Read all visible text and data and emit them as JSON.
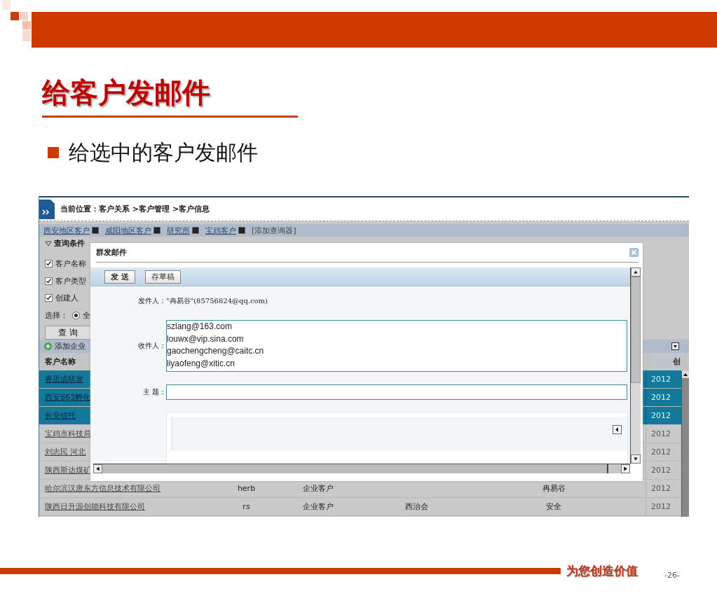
{
  "slide": {
    "title": "给客户发邮件",
    "bullets": [
      "给选中的客户发邮件"
    ],
    "slogan": "为您创造价值",
    "page": "-26-"
  },
  "app": {
    "breadcrumb": "当前位置：客户关系 >客户管理 >客户信息",
    "query_tabs": [
      {
        "label": "西安地区客户",
        "kind": "saved"
      },
      {
        "label": "咸阳地区客户",
        "kind": "saved"
      },
      {
        "label": "研究所",
        "kind": "saved"
      },
      {
        "label": "宝鸡客户",
        "kind": "saved"
      },
      {
        "label": "[添加查询器]",
        "kind": "add"
      }
    ],
    "query_panel": {
      "title": "查询条件",
      "expanded": true,
      "conditions": [
        {
          "label": "客户名称",
          "checked": true
        },
        {
          "label": "客户类型",
          "checked": true
        },
        {
          "label": "创建人",
          "checked": true
        }
      ],
      "select_label": "选择：",
      "select_option": {
        "label": "全",
        "selected": true
      },
      "search_button": "查 询"
    },
    "add_link": "添加企业",
    "table": {
      "columns": [
        "客户名称",
        "创"
      ],
      "rows": [
        {
          "name": "睿思成研发",
          "year": "2012",
          "selected": true
        },
        {
          "name": "西安863孵化",
          "year": "2012",
          "selected": true
        },
        {
          "name": "长安信托",
          "year": "2012",
          "selected": true
        },
        {
          "name": "宝鸡市科技局",
          "year": "2012",
          "selected": false
        },
        {
          "name": "刘志民 河北",
          "year": "2012",
          "selected": false
        },
        {
          "name": "陕西斯达煤矿",
          "year": "2012",
          "selected": false
        },
        {
          "name": "哈尔滨汉唐东方信息技术有限公司",
          "code": "herb",
          "type": "企业客户",
          "creator": "冉易谷",
          "year": "2012",
          "selected": false
        },
        {
          "name": "陕西日升源创能科技有限公司",
          "code": "rs",
          "type": "企业客户",
          "region": "西治会",
          "creator": "安全",
          "year": "2012",
          "selected": false
        }
      ]
    }
  },
  "dialog": {
    "title": "群发邮件",
    "buttons": [
      "发 送",
      "存草稿"
    ],
    "sender_label": "发件人：",
    "sender": "\"冉易谷\"(85756824@qq.com)",
    "recipients_label": "收件人：",
    "recipients": [
      "szlang@163.com",
      "louwx@vip.sina.com",
      "gaochengcheng@caitc.cn",
      "liyaofeng@xitic.cn"
    ],
    "subject_label": "主 题："
  }
}
